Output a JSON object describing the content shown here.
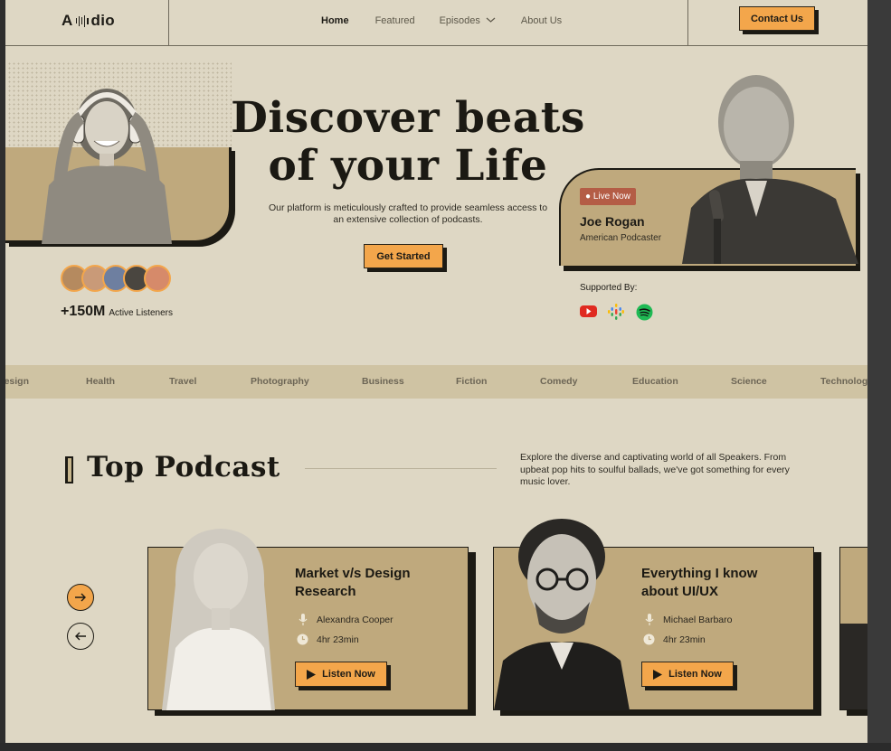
{
  "brand": {
    "logo_left": "A",
    "logo_right": "dio"
  },
  "nav": {
    "items": [
      {
        "label": "Home",
        "active": true
      },
      {
        "label": "Featured",
        "active": false
      },
      {
        "label": "Episodes",
        "active": false
      },
      {
        "label": "About Us",
        "active": false
      }
    ],
    "contact_label": "Contact Us"
  },
  "hero": {
    "title_line1": "Discover beats",
    "title_line2": "of your Life",
    "subtitle": "Our platform is meticulously crafted to provide seamless access to an extensive collection of podcasts.",
    "cta_label": "Get Started",
    "listeners_count": "+150M",
    "listeners_label": "Active Listeners"
  },
  "live": {
    "badge": "Live Now",
    "name": "Joe Rogan",
    "role": "American Podcaster"
  },
  "supported": {
    "label": "Supported By:",
    "brands": [
      "youtube-icon",
      "google-podcasts-icon",
      "spotify-icon"
    ]
  },
  "categories": [
    "Design",
    "Health",
    "Travel",
    "Photography",
    "Business",
    "Fiction",
    "Comedy",
    "Education",
    "Science",
    "Technology"
  ],
  "top_podcast": {
    "title": "Top Podcast",
    "description": "Explore the diverse and captivating world of all Speakers. From upbeat pop hits to soulful ballads, we've got something for every music lover.",
    "cards": [
      {
        "title_line1": "Market v/s Design",
        "title_line2": "Research",
        "host": "Alexandra Cooper",
        "duration": "4hr 23min",
        "cta": "Listen Now"
      },
      {
        "title_line1": "Everything I know",
        "title_line2": "about UI/UX",
        "host": "Michael Barbaro",
        "duration": "4hr 23min",
        "cta": "Listen Now"
      }
    ]
  },
  "colors": {
    "accent": "#f3a64b",
    "card": "#bfa97d",
    "background": "#ded7c4",
    "live_badge": "#b45d46"
  }
}
